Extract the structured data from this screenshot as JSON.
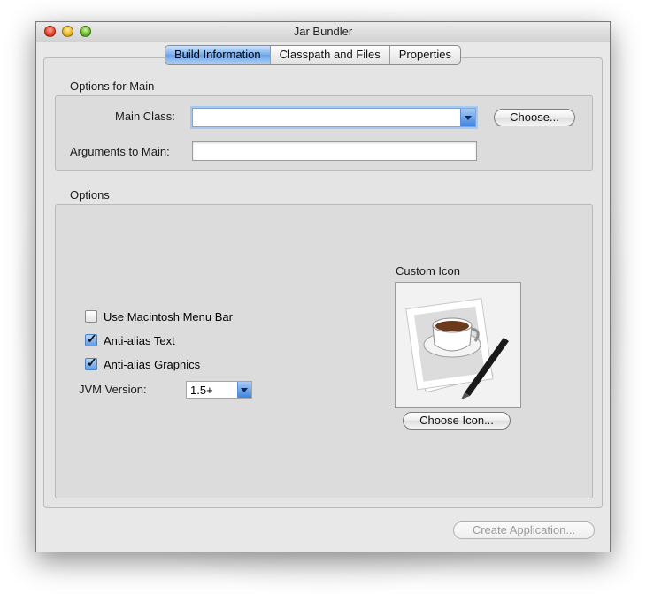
{
  "window": {
    "title": "Jar Bundler"
  },
  "tabs": [
    {
      "label": "Build Information",
      "active": true
    },
    {
      "label": "Classpath and Files",
      "active": false
    },
    {
      "label": "Properties",
      "active": false
    }
  ],
  "options_for_main": {
    "section_label": "Options for Main",
    "main_class_label": "Main Class:",
    "main_class_value": "",
    "choose_button": "Choose...",
    "arguments_label": "Arguments to Main:",
    "arguments_value": ""
  },
  "options": {
    "section_label": "Options",
    "checkboxes": [
      {
        "label": "Use Macintosh Menu Bar",
        "checked": false
      },
      {
        "label": "Anti-alias Text",
        "checked": true
      },
      {
        "label": "Anti-alias Graphics",
        "checked": true
      }
    ],
    "jvm_label": "JVM Version:",
    "jvm_value": "1.5+",
    "custom_icon_label": "Custom Icon",
    "choose_icon_button": "Choose Icon...",
    "icon_name": "java-coffee-cup-icon"
  },
  "footer": {
    "create_button": "Create Application...",
    "create_enabled": false
  },
  "colors": {
    "tab_active": "#79adeb",
    "window_bg": "#e8e8e8"
  }
}
